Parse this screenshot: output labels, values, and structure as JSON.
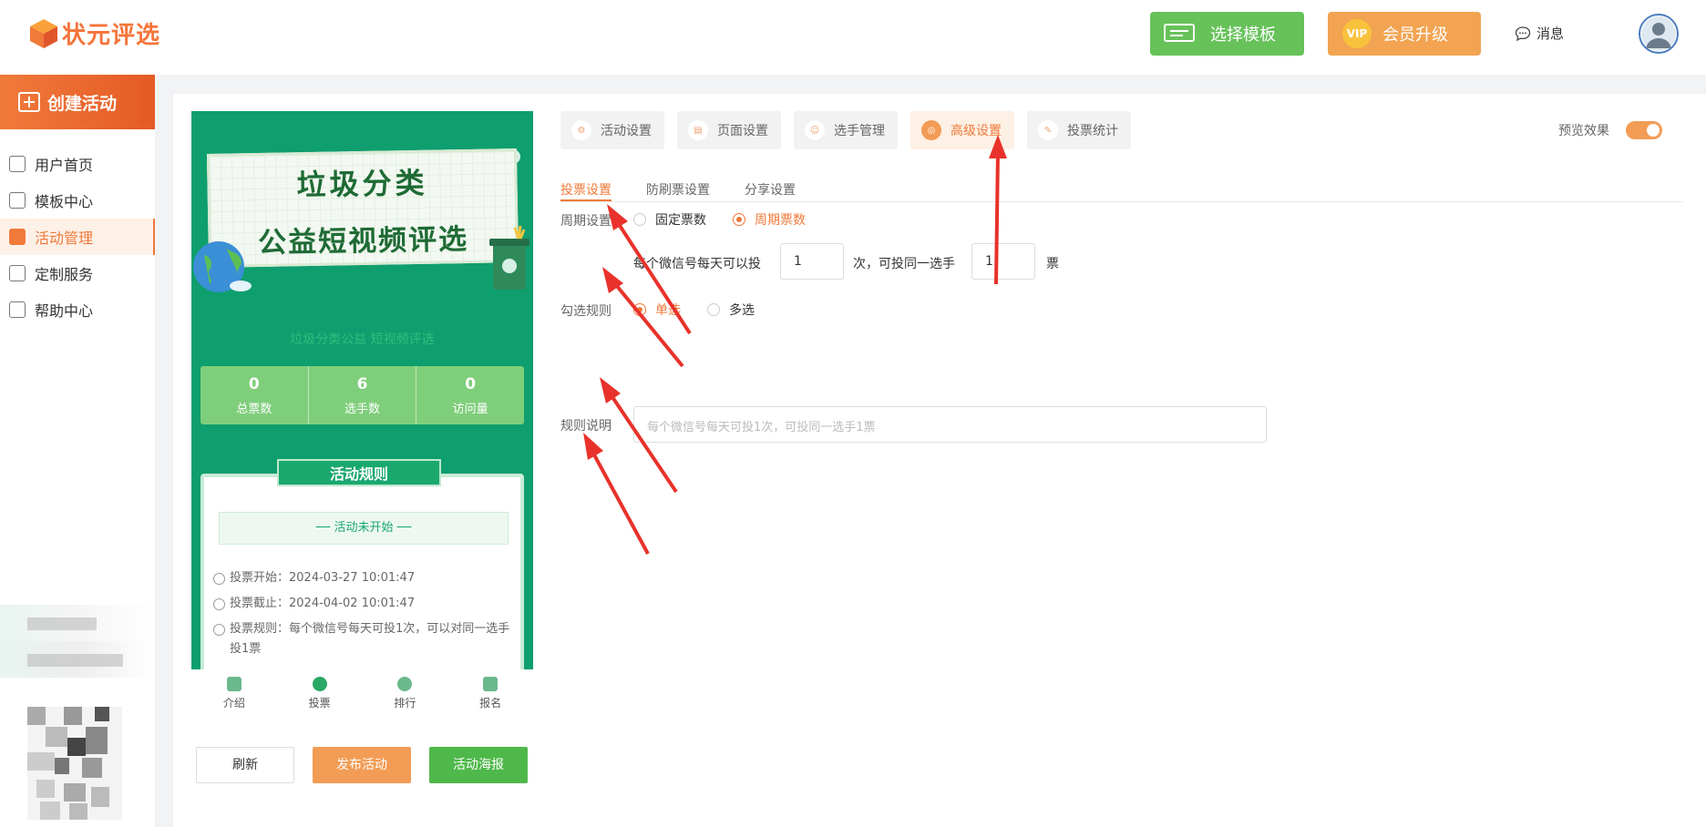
{
  "app": {
    "logo_text": "状元评选"
  },
  "header": {
    "template_button": "选择模板",
    "vip_badge": "VIP",
    "vip_button": "会员升级",
    "messages": "消息"
  },
  "sidebar": {
    "create_button": "创建活动",
    "items": [
      {
        "label": "用户首页",
        "icon": "home-icon"
      },
      {
        "label": "模板中心",
        "icon": "template-icon"
      },
      {
        "label": "活动管理",
        "icon": "activity-icon",
        "active": true
      },
      {
        "label": "定制服务",
        "icon": "custom-icon"
      },
      {
        "label": "帮助中心",
        "icon": "help-icon"
      }
    ]
  },
  "phone": {
    "banner_title_1": "垃圾分类",
    "banner_title_2": "公益短视频评选",
    "subtitle": "垃圾分类公益 短视频评选",
    "stats": [
      {
        "value": "0",
        "label": "总票数"
      },
      {
        "value": "6",
        "label": "选手数"
      },
      {
        "value": "0",
        "label": "访问量"
      }
    ],
    "rules_title": "活动规则",
    "rules_status": "── 活动未开始 ──",
    "vote_start_label": "投票开始：",
    "vote_start": "2024-03-27 10:01:47",
    "vote_end_label": "投票截止：",
    "vote_end": "2024-04-02 10:01:47",
    "vote_rule_label": "投票规则：",
    "vote_rule": "每个微信号每天可投1次，可以对同一选手投1票",
    "tabbar": [
      "介绍",
      "投票",
      "排行",
      "报名"
    ]
  },
  "buttons": {
    "refresh": "刷新",
    "publish": "发布活动",
    "poster": "活动海报"
  },
  "top_tabs": [
    {
      "label": "活动设置"
    },
    {
      "label": "页面设置"
    },
    {
      "label": "选手管理"
    },
    {
      "label": "高级设置",
      "active": true
    },
    {
      "label": "投票统计"
    }
  ],
  "preview": {
    "label": "预览效果",
    "enabled": true
  },
  "sub_tabs": [
    {
      "label": "投票设置",
      "active": true
    },
    {
      "label": "防刷票设置"
    },
    {
      "label": "分享设置"
    }
  ],
  "form": {
    "period_label": "周期设置",
    "period_options": [
      "固定票数",
      "周期票数"
    ],
    "period_selected": "周期票数",
    "per_day_prefix": "每个微信号每天可以投",
    "per_day_value": "1",
    "per_day_mid": "次，可投同一选手",
    "per_player_value": "1",
    "per_player_suffix": "票",
    "select_rule_label": "勾选规则",
    "select_options": [
      "单选",
      "多选"
    ],
    "select_selected": "单选",
    "rule_desc_label": "规则说明",
    "rule_desc_placeholder": "每个微信号每天可投1次，可投同一选手1票"
  },
  "colors": {
    "accent": "#f07a3a",
    "green": "#0f9e6e",
    "arrow": "#e8322b"
  }
}
